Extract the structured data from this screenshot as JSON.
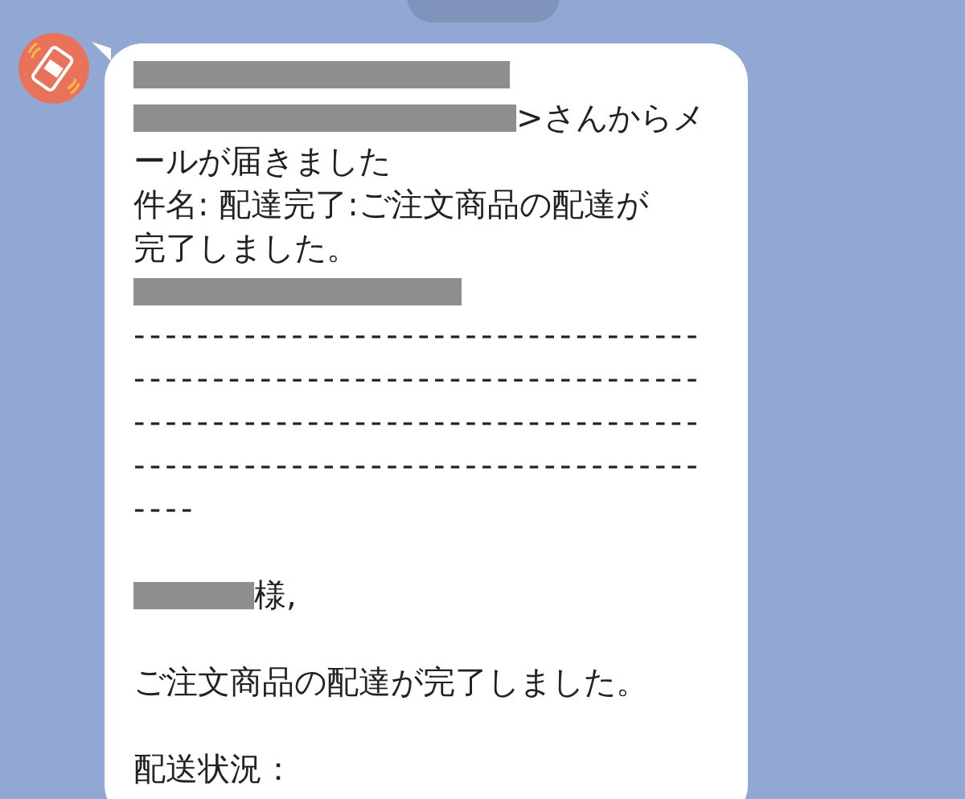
{
  "message": {
    "lines": [
      {
        "kind": "redacted"
      },
      {
        "kind": "redacted_text",
        "text": ">さんからメ"
      },
      {
        "kind": "text",
        "text": "ールが届きました"
      },
      {
        "kind": "text",
        "text": "件名: 配達完了:ご注文商品の配達が"
      },
      {
        "kind": "text",
        "text": "完了しました。"
      },
      {
        "kind": "redacted"
      },
      {
        "kind": "rule",
        "text": "------------------------------------"
      },
      {
        "kind": "rule",
        "text": "------------------------------------"
      },
      {
        "kind": "rule",
        "text": "------------------------------------"
      },
      {
        "kind": "rule",
        "text": "------------------------------------"
      },
      {
        "kind": "rule",
        "text": "----"
      },
      {
        "kind": "blank"
      },
      {
        "kind": "redacted_text",
        "text": "様,"
      },
      {
        "kind": "blank"
      },
      {
        "kind": "text",
        "text": "ご注文商品の配達が完了しました。"
      },
      {
        "kind": "blank"
      },
      {
        "kind": "text",
        "text": "配送状況："
      }
    ]
  }
}
